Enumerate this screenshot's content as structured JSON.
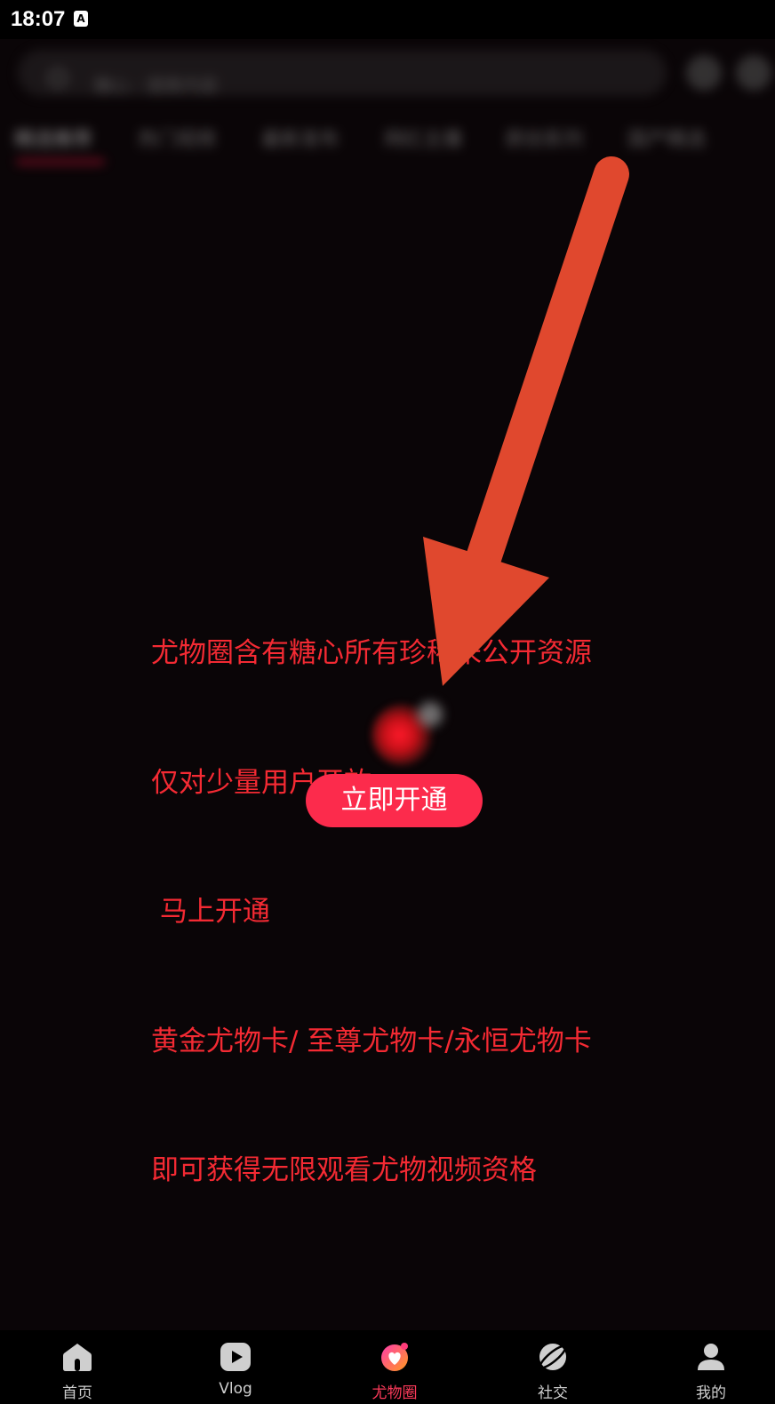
{
  "status_bar": {
    "time": "18:07",
    "indicator": "A"
  },
  "header": {
    "search_placeholder": "糖心 · 搜索内容",
    "tabs": [
      "精选推荐",
      "热门视频",
      "最新发布",
      "网红主播",
      "原创系列",
      "国产精选"
    ]
  },
  "promo": {
    "lines": [
      "尤物圈含有糖心所有珍稀未公开资源",
      "仅对少量用户开放",
      " 马上开通",
      "黄金尤物卡/ 至尊尤物卡/永恒尤物卡",
      "即可获得无限观看尤物视频资格"
    ],
    "button_label": "立即开通",
    "text_color": "#f42a33",
    "button_color": "#fc2b4c"
  },
  "bottom_nav": {
    "items": [
      {
        "label": "首页",
        "icon": "home-icon"
      },
      {
        "label": "Vlog",
        "icon": "play-icon"
      },
      {
        "label": "尤物圈",
        "icon": "heart-circle-icon",
        "active": true
      },
      {
        "label": "社交",
        "icon": "planet-icon"
      },
      {
        "label": "我的",
        "icon": "user-icon"
      }
    ],
    "active_color": "#fc3a5a"
  },
  "annotation": {
    "arrow_color": "#e0482e"
  }
}
